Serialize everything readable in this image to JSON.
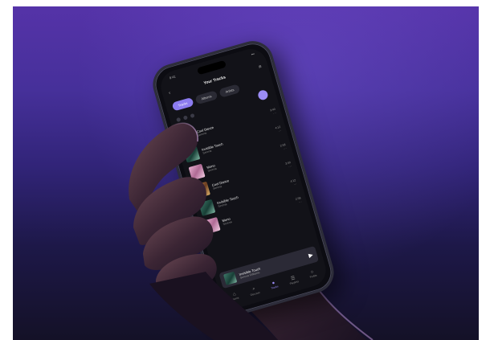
{
  "app": {
    "title": "Your Tracks",
    "status_time": "9:41",
    "status_signal": "•••"
  },
  "icons": {
    "back": "chevron-left-icon",
    "menu": "hamburger-menu-icon",
    "play": "play-icon",
    "fab": "shuffle-icon"
  },
  "chips": [
    {
      "label": "Tracks",
      "active": true
    },
    {
      "label": "Albums",
      "active": false
    },
    {
      "label": "Artists",
      "active": false
    }
  ],
  "tracks": [
    {
      "name": "Cool Dance",
      "artist": "Serena",
      "duration": "3:40",
      "more": "⋯",
      "art": "a"
    },
    {
      "name": "Invisible Touch",
      "artist": "Serena",
      "duration": "4:12",
      "more": "⋯",
      "art": "b"
    },
    {
      "name": "Mono",
      "artist": "Serena",
      "duration": "2:58",
      "more": "⋯",
      "art": "c"
    },
    {
      "name": "Cool Dance",
      "artist": "Serena",
      "duration": "3:40",
      "more": "⋯",
      "art": "a"
    },
    {
      "name": "Invisible Touch",
      "artist": "Serena",
      "duration": "4:12",
      "more": "⋯",
      "art": "b"
    },
    {
      "name": "Mono",
      "artist": "Serena",
      "duration": "2:58",
      "more": "⋯",
      "art": "c"
    }
  ],
  "now_playing": {
    "title": "Invisible Touch",
    "artist": "Serena Williams",
    "play_glyph": "▶"
  },
  "tabs": [
    {
      "label": "Home",
      "glyph": "⌂",
      "active": false
    },
    {
      "label": "Discover",
      "glyph": "⌕",
      "active": false
    },
    {
      "label": "Tracks",
      "glyph": "●",
      "active": true
    },
    {
      "label": "Playlists",
      "glyph": "☰",
      "active": false
    },
    {
      "label": "Profile",
      "glyph": "○",
      "active": false
    }
  ],
  "colors": {
    "accent": "#9b8cf5",
    "background_top": "#5533a8",
    "background_bottom": "#141127"
  }
}
